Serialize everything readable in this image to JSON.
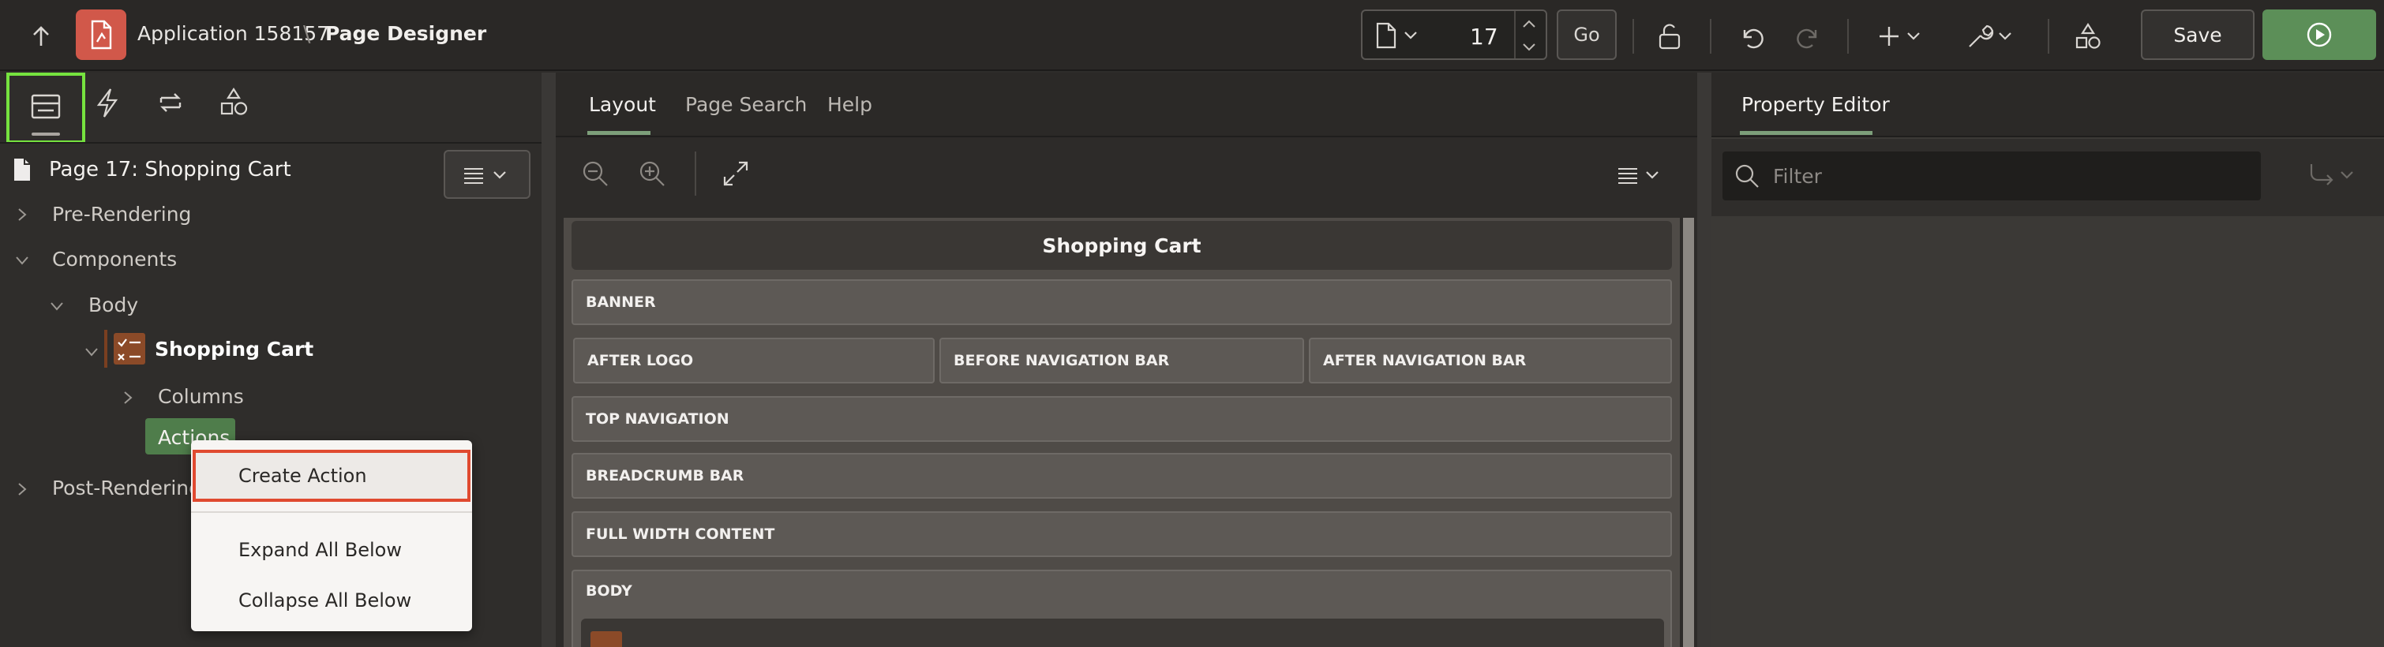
{
  "header": {
    "app_name": "Application 158157",
    "separator": "\\",
    "page_name": "Page Designer",
    "page_number": "17",
    "go_label": "Go",
    "save_label": "Save"
  },
  "left_panel": {
    "page_title": "Page 17: Shopping Cart",
    "tree": {
      "pre_rendering": "Pre-Rendering",
      "components": "Components",
      "body": "Body",
      "shopping_cart": "Shopping Cart",
      "columns": "Columns",
      "actions": "Actions",
      "post_rendering": "Post-Rendering"
    }
  },
  "context_menu": {
    "items": [
      "Create Action",
      "Expand All Below",
      "Collapse All Below"
    ]
  },
  "middle_panel": {
    "tabs": [
      "Layout",
      "Page Search",
      "Help"
    ],
    "page_header": "Shopping Cart",
    "regions": {
      "banner": "BANNER",
      "after_logo": "AFTER LOGO",
      "before_nav": "BEFORE NAVIGATION BAR",
      "after_nav": "AFTER NAVIGATION BAR",
      "top_nav": "TOP NAVIGATION",
      "breadcrumb": "BREADCRUMB BAR",
      "full_width": "FULL WIDTH CONTENT",
      "body": "BODY"
    }
  },
  "right_panel": {
    "tab": "Property Editor",
    "filter_placeholder": "Filter"
  },
  "colors": {
    "accent_green": "#5c8f58",
    "app_icon_red": "#d1584a",
    "focus_green": "#76e33f",
    "highlight_red": "#e04a30",
    "tab_underline": "#7d9f7a"
  }
}
